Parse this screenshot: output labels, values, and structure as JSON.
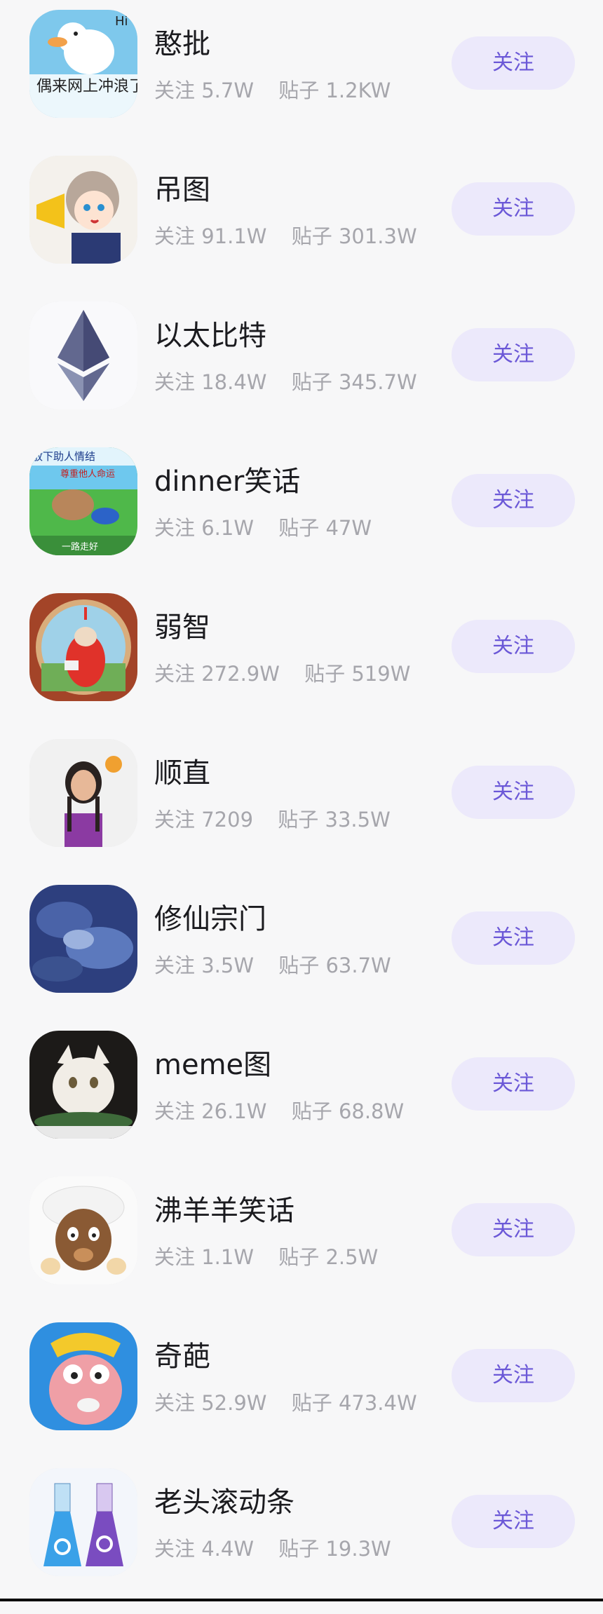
{
  "communities": [
    {
      "name": "憨批",
      "follow_label": "关注",
      "stats": {
        "followers_label": "关注",
        "followers": "5.7W",
        "posts_label": "贴子",
        "posts": "1.2KW"
      },
      "avatar": {
        "icon": "duck-avatar-icon",
        "caption": "偶来网上冲浪了",
        "badge": "Hi"
      }
    },
    {
      "name": "吊图",
      "follow_label": "关注",
      "stats": {
        "followers_label": "关注",
        "followers": "91.1W",
        "posts_label": "贴子",
        "posts": "301.3W"
      },
      "avatar": {
        "icon": "anime-megaphone-icon"
      }
    },
    {
      "name": "以太比特",
      "follow_label": "关注",
      "stats": {
        "followers_label": "关注",
        "followers": "18.4W",
        "posts_label": "贴子",
        "posts": "345.7W"
      },
      "avatar": {
        "icon": "ethereum-icon"
      }
    },
    {
      "name": "dinner笑话",
      "follow_label": "关注",
      "stats": {
        "followers_label": "关注",
        "followers": "6.1W",
        "posts_label": "贴子",
        "posts": "47W"
      },
      "avatar": {
        "icon": "cartoon-dog-icon",
        "caption_top": "放下助人情结",
        "caption_mid": "尊重他人命运",
        "caption_bottom": "一路走好"
      }
    },
    {
      "name": "弱智",
      "follow_label": "关注",
      "stats": {
        "followers_label": "关注",
        "followers": "272.9W",
        "posts_label": "贴子",
        "posts": "519W"
      },
      "avatar": {
        "icon": "teletubby-icon"
      }
    },
    {
      "name": "顺直",
      "follow_label": "关注",
      "stats": {
        "followers_label": "关注",
        "followers": "7209",
        "posts_label": "贴子",
        "posts": "33.5W"
      },
      "avatar": {
        "icon": "portrait-woman-icon"
      }
    },
    {
      "name": "修仙宗门",
      "follow_label": "关注",
      "stats": {
        "followers_label": "关注",
        "followers": "3.5W",
        "posts_label": "贴子",
        "posts": "63.7W"
      },
      "avatar": {
        "icon": "cloudy-sky-icon"
      }
    },
    {
      "name": "meme图",
      "follow_label": "关注",
      "stats": {
        "followers_label": "关注",
        "followers": "26.1W",
        "posts_label": "贴子",
        "posts": "68.8W"
      },
      "avatar": {
        "icon": "white-cat-icon"
      }
    },
    {
      "name": "沸羊羊笑话",
      "follow_label": "关注",
      "stats": {
        "followers_label": "关注",
        "followers": "1.1W",
        "posts_label": "贴子",
        "posts": "2.5W"
      },
      "avatar": {
        "icon": "cartoon-goat-icon"
      }
    },
    {
      "name": "奇葩",
      "follow_label": "关注",
      "stats": {
        "followers_label": "关注",
        "followers": "52.9W",
        "posts_label": "贴子",
        "posts": "473.4W"
      },
      "avatar": {
        "icon": "pink-fish-icon"
      }
    },
    {
      "name": "老头滚动条",
      "follow_label": "关注",
      "stats": {
        "followers_label": "关注",
        "followers": "4.4W",
        "posts_label": "贴子",
        "posts": "19.3W"
      },
      "avatar": {
        "icon": "gender-flasks-icon"
      }
    }
  ],
  "colors": {
    "follow_bg": "#ece9fb",
    "follow_text": "#6b58d7",
    "name": "#1b1b1f",
    "stats": "#a6a6ac",
    "background": "#f7f7f8"
  }
}
